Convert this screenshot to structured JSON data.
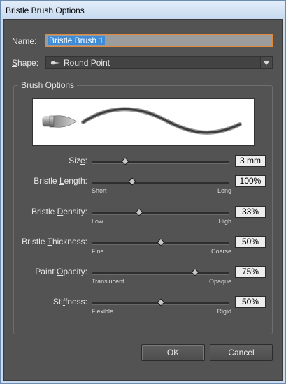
{
  "window": {
    "title": "Bristle Brush Options"
  },
  "name": {
    "label_pre": "",
    "label_u": "N",
    "label_post": "ame:",
    "value": "Bristle Brush 1"
  },
  "shape": {
    "label_pre": "",
    "label_u": "S",
    "label_post": "hape:",
    "value": "Round Point"
  },
  "brush_options": {
    "title": "Brush Options"
  },
  "sliders": [
    {
      "pre": "Siz",
      "u": "e",
      "post": ":",
      "min": "",
      "max": "",
      "value": "3 mm",
      "fraction": 0.24
    },
    {
      "pre": "Bristle ",
      "u": "L",
      "post": "ength:",
      "min": "Short",
      "max": "Long",
      "value": "100%",
      "fraction": 0.29
    },
    {
      "pre": "Bristle ",
      "u": "D",
      "post": "ensity:",
      "min": "Low",
      "max": "High",
      "value": "33%",
      "fraction": 0.34
    },
    {
      "pre": "Bristle ",
      "u": "T",
      "post": "hickness:",
      "min": "Fine",
      "max": "Coarse",
      "value": "50%",
      "fraction": 0.5
    },
    {
      "pre": "Paint ",
      "u": "O",
      "post": "pacity:",
      "min": "Translucent",
      "max": "Opaque",
      "value": "75%",
      "fraction": 0.75
    },
    {
      "pre": "Sti",
      "u": "f",
      "post": "fness:",
      "min": "Flexible",
      "max": "Rigid",
      "value": "50%",
      "fraction": 0.5
    }
  ],
  "buttons": {
    "ok": "OK",
    "cancel": "Cancel"
  }
}
